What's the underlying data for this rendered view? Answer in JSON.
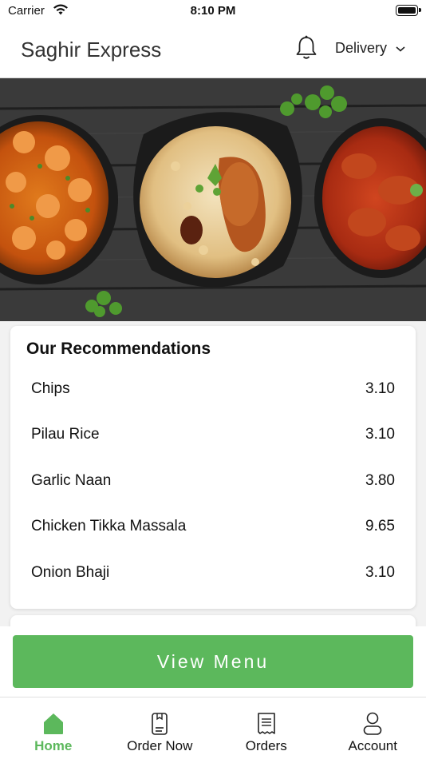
{
  "status_bar": {
    "carrier": "Carrier",
    "time": "8:10 PM"
  },
  "header": {
    "title": "Saghir Express",
    "mode": "Delivery",
    "bell_icon": "bell-icon",
    "chevron_icon": "chevron-down-icon"
  },
  "recommendations": {
    "title": "Our Recommendations",
    "items": [
      {
        "name": "Chips",
        "price": "3.10"
      },
      {
        "name": "Pilau Rice",
        "price": "3.10"
      },
      {
        "name": "Garlic Naan",
        "price": "3.80"
      },
      {
        "name": "Chicken Tikka Massala",
        "price": "9.65"
      },
      {
        "name": "Onion Bhaji",
        "price": "3.10"
      }
    ]
  },
  "view_menu_label": "View Menu",
  "tabs": [
    {
      "label": "Home",
      "icon": "home-icon",
      "active": true
    },
    {
      "label": "Order Now",
      "icon": "order-icon",
      "active": false
    },
    {
      "label": "Orders",
      "icon": "receipt-icon",
      "active": false
    },
    {
      "label": "Account",
      "icon": "user-icon",
      "active": false
    }
  ],
  "colors": {
    "accent": "#5cb85c",
    "header_bg": "#ffffff",
    "page_bg": "#f2f2f2"
  }
}
